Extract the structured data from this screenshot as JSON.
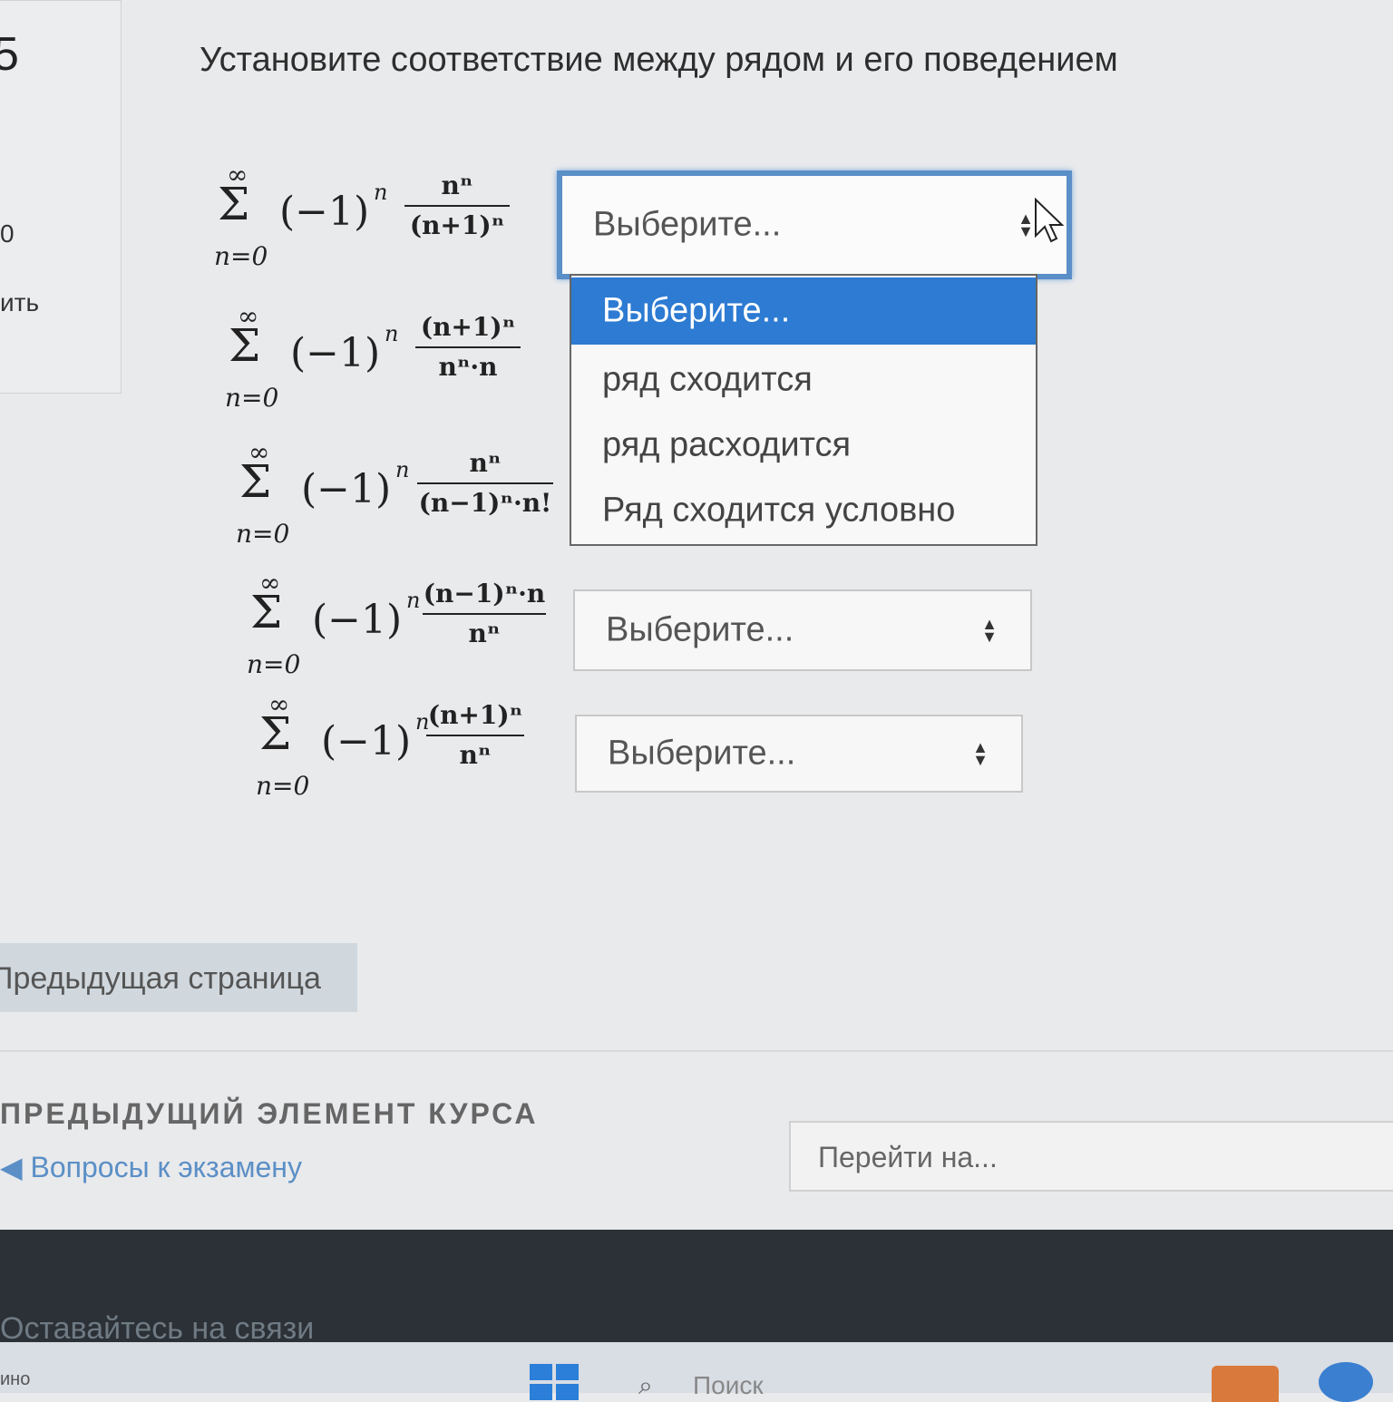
{
  "side_panel": {
    "question_number": "5",
    "mark_fragment": "0",
    "flag_fragment": "ить"
  },
  "question": {
    "title": "Установите соответствие между  рядом и его поведением"
  },
  "series": [
    {
      "upper": "∞",
      "lower": "n=0",
      "base": "(−1)",
      "power": "n",
      "numerator": "nⁿ",
      "denominator": "(n+1)ⁿ",
      "select_value": "Выберите..."
    },
    {
      "upper": "∞",
      "lower": "n=0",
      "base": "(−1)",
      "power": "n",
      "numerator": "(n+1)ⁿ",
      "denominator": "nⁿ·n",
      "select_value": "Выберите..."
    },
    {
      "upper": "∞",
      "lower": "n=0",
      "base": "(−1)",
      "power": "n",
      "numerator": "nⁿ",
      "denominator": "(n−1)ⁿ·n!",
      "select_value": "Выберите..."
    },
    {
      "upper": "∞",
      "lower": "n=0",
      "base": "(−1)",
      "power": "n",
      "numerator": "(n−1)ⁿ·n",
      "denominator": "nⁿ",
      "select_value": "Выберите..."
    },
    {
      "upper": "∞",
      "lower": "n=0",
      "base": "(−1)",
      "power": "n",
      "numerator": "(n+1)ⁿ",
      "denominator": "nⁿ",
      "select_value": "Выберите..."
    }
  ],
  "dropdown": {
    "options": [
      "Выберите...",
      "ряд сходится",
      "ряд расходится",
      "Ряд сходится условно"
    ],
    "selected_index": 0,
    "accent_color": "#2d7bd2"
  },
  "nav": {
    "prev_page_button": "Предыдущая страница",
    "prev_element_heading": "ПРЕДЫДУЩИЙ ЭЛЕМЕНТ КУРСА",
    "prev_element_link": "Вопросы к экзамену",
    "jump_placeholder": "Перейти на..."
  },
  "footer": {
    "text": "Оставайтесь на связи"
  },
  "taskbar": {
    "left_fragment": "ино",
    "search_placeholder": "Поиск"
  }
}
